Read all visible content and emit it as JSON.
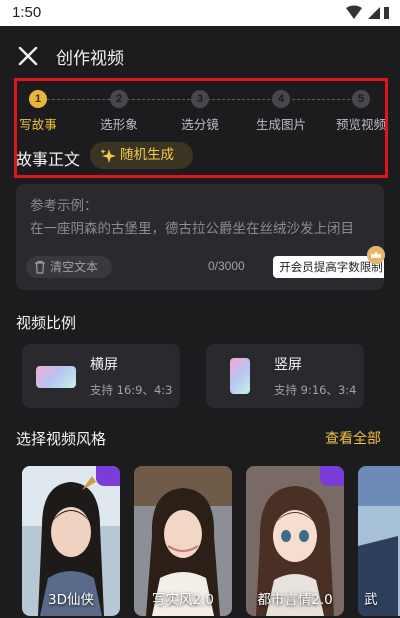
{
  "status_bar": {
    "time": "1:50"
  },
  "header": {
    "title": "创作视频"
  },
  "steps": [
    {
      "num": "1",
      "label": "写故事",
      "active": true
    },
    {
      "num": "2",
      "label": "选形象",
      "active": false
    },
    {
      "num": "3",
      "label": "选分镜",
      "active": false
    },
    {
      "num": "4",
      "label": "生成图片",
      "active": false
    },
    {
      "num": "5",
      "label": "预览视频",
      "active": false
    }
  ],
  "story": {
    "title": "故事正文",
    "random_label": "随机生成",
    "sample_label": "参考示例：",
    "sample_text": "在一座阴森的古堡里，德古拉公爵坐在丝绒沙发上闭目",
    "clear_label": "清空文本",
    "count": "0/3000",
    "vip_label": "开会员提高字数限制"
  },
  "ratio": {
    "title": "视频比例",
    "options": [
      {
        "name": "横屏",
        "desc": "支持 16:9、4:3"
      },
      {
        "name": "竖屏",
        "desc": "支持 9:16、3:4"
      }
    ]
  },
  "styles": {
    "title": "选择视频风格",
    "see_all": "查看全部",
    "items": [
      {
        "label": "3D仙侠"
      },
      {
        "label": "写实风2.0"
      },
      {
        "label": "都市言情2.0"
      },
      {
        "label": "武"
      }
    ]
  },
  "colors": {
    "accent": "#f0c33c",
    "highlight": "#e0141c",
    "background": "#1c1c1e",
    "card": "#2a2a2e"
  }
}
